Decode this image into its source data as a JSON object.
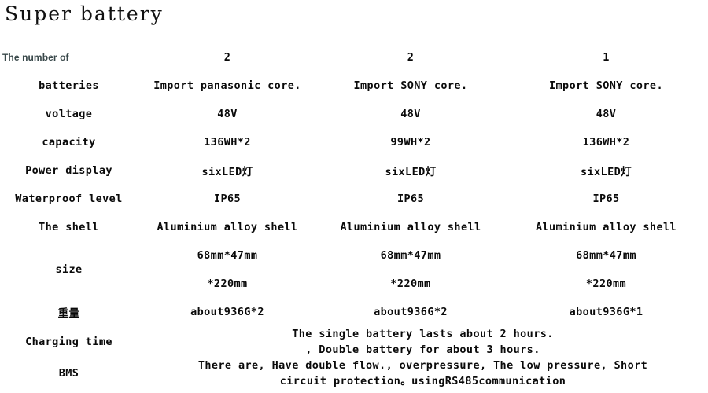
{
  "document": {
    "title": "Super battery",
    "background_color": "#ffffff",
    "text_color": "#000000",
    "header_label_color": "#39484a"
  },
  "table": {
    "row_labels": {
      "number_of": "The number of",
      "batteries": "batteries",
      "voltage": "voltage",
      "capacity": "capacity",
      "power_display": "Power display",
      "waterproof_level": "Waterproof level",
      "the_shell": "The shell",
      "size": "size",
      "weight": "重量",
      "charging_time": "Charging time",
      "bms": "BMS"
    },
    "columns": [
      {
        "number_of": "2",
        "batteries": "Import panasonic core.",
        "voltage": "48V",
        "capacity": "136WH*2",
        "power_display": "sixLED灯",
        "waterproof_level": "IP65",
        "the_shell": "Aluminium alloy shell",
        "size_line1": "68mm*47mm",
        "size_line2": "*220mm",
        "weight": "about936G*2"
      },
      {
        "number_of": "2",
        "batteries": "Import SONY core.",
        "voltage": "48V",
        "capacity": "99WH*2",
        "power_display": "sixLED灯",
        "waterproof_level": "IP65",
        "the_shell": "Aluminium alloy shell",
        "size_line1": "68mm*47mm",
        "size_line2": "*220mm",
        "weight": "about936G*2"
      },
      {
        "number_of": "1",
        "batteries": "Import SONY core.",
        "voltage": "48V",
        "capacity": "136WH*2",
        "power_display": "sixLED灯",
        "waterproof_level": "IP65",
        "the_shell": "Aluminium alloy shell",
        "size_line1": "68mm*47mm",
        "size_line2": "*220mm",
        "weight": "about936G*1"
      }
    ],
    "spanning_rows": {
      "charging_time": {
        "line1": "The single battery lasts about 2 hours.",
        "line2": ", Double battery for about 3 hours."
      },
      "bms": {
        "line1": "There are, Have double flow., overpressure, The low pressure, Short",
        "line2": "circuit protection。usingRS485communication"
      }
    }
  }
}
